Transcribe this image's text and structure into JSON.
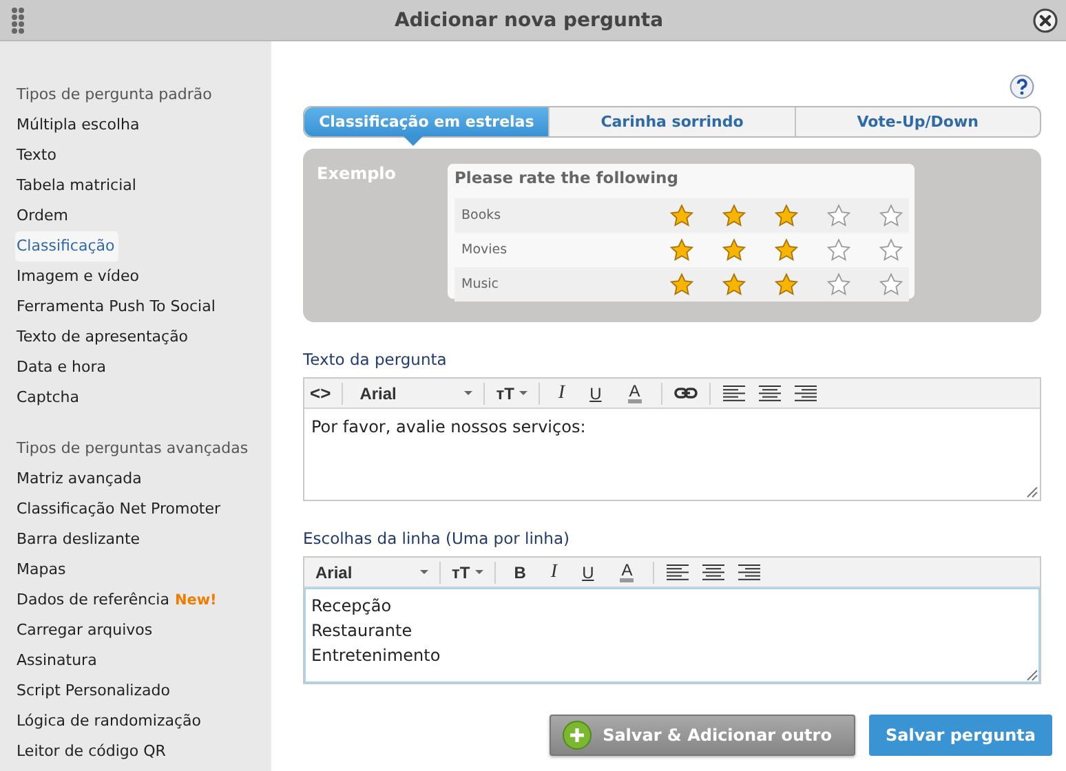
{
  "window": {
    "title": "Adicionar nova pergunta"
  },
  "sidebar": {
    "groups": [
      {
        "heading": "Tipos de pergunta padrão",
        "items": [
          {
            "label": "Múltipla escolha",
            "selected": false
          },
          {
            "label": "Texto",
            "selected": false
          },
          {
            "label": "Tabela matricial",
            "selected": false
          },
          {
            "label": "Ordem",
            "selected": false
          },
          {
            "label": "Classificação",
            "selected": true
          },
          {
            "label": "Imagem e vídeo",
            "selected": false
          },
          {
            "label": "Ferramenta Push To Social",
            "selected": false
          },
          {
            "label": "Texto de apresentação",
            "selected": false
          },
          {
            "label": "Data e hora",
            "selected": false
          },
          {
            "label": "Captcha",
            "selected": false
          }
        ]
      },
      {
        "heading": "Tipos de perguntas avançadas",
        "items": [
          {
            "label": "Matriz avançada",
            "selected": false
          },
          {
            "label": "Classificação Net Promoter",
            "selected": false
          },
          {
            "label": "Barra deslizante",
            "selected": false
          },
          {
            "label": "Mapas",
            "selected": false
          },
          {
            "label": "Dados de referência",
            "selected": false,
            "badge": "New!"
          },
          {
            "label": "Carregar arquivos",
            "selected": false
          },
          {
            "label": "Assinatura",
            "selected": false
          },
          {
            "label": "Script Personalizado",
            "selected": false
          },
          {
            "label": "Lógica de randomização",
            "selected": false
          },
          {
            "label": "Leitor de código QR",
            "selected": false
          }
        ]
      }
    ]
  },
  "tabs": [
    {
      "label": "Classificação em estrelas",
      "selected": true
    },
    {
      "label": "Carinha sorrindo",
      "selected": false
    },
    {
      "label": "Vote-Up/Down",
      "selected": false
    }
  ],
  "example": {
    "label": "Exemplo",
    "title": "Please rate the following",
    "rows": [
      {
        "label": "Books",
        "stars": 3
      },
      {
        "label": "Movies",
        "stars": 3
      },
      {
        "label": "Music",
        "stars": 3
      }
    ]
  },
  "fields": [
    {
      "label": "Texto da pergunta",
      "focused": false,
      "toolbar": [
        {
          "kind": "code",
          "label": "<>"
        },
        {
          "kind": "font",
          "label": "Arial"
        },
        {
          "kind": "size",
          "label": "тT"
        },
        {
          "kind": "italic",
          "label": "I"
        },
        {
          "kind": "underline",
          "label": "U"
        },
        {
          "kind": "color",
          "label": "A"
        },
        {
          "kind": "link"
        },
        {
          "kind": "align-left"
        },
        {
          "kind": "align-center"
        },
        {
          "kind": "align-right"
        }
      ],
      "lines": [
        "Por favor, avalie nossos serviços:"
      ]
    },
    {
      "label": "Escolhas da linha (Uma por linha)",
      "focused": true,
      "toolbar": [
        {
          "kind": "font",
          "label": "Arial"
        },
        {
          "kind": "size",
          "label": "тT"
        },
        {
          "kind": "bold",
          "label": "B"
        },
        {
          "kind": "italic",
          "label": "I"
        },
        {
          "kind": "underline",
          "label": "U"
        },
        {
          "kind": "color",
          "label": "A"
        },
        {
          "kind": "align-left"
        },
        {
          "kind": "align-center"
        },
        {
          "kind": "align-right"
        }
      ],
      "lines": [
        "Recepção",
        "Restaurante",
        "Entretenimento"
      ]
    }
  ],
  "buttons": [
    {
      "kind": "secondary",
      "label": "Salvar & Adicionar outro"
    },
    {
      "kind": "primary",
      "label": "Salvar pergunta"
    }
  ]
}
